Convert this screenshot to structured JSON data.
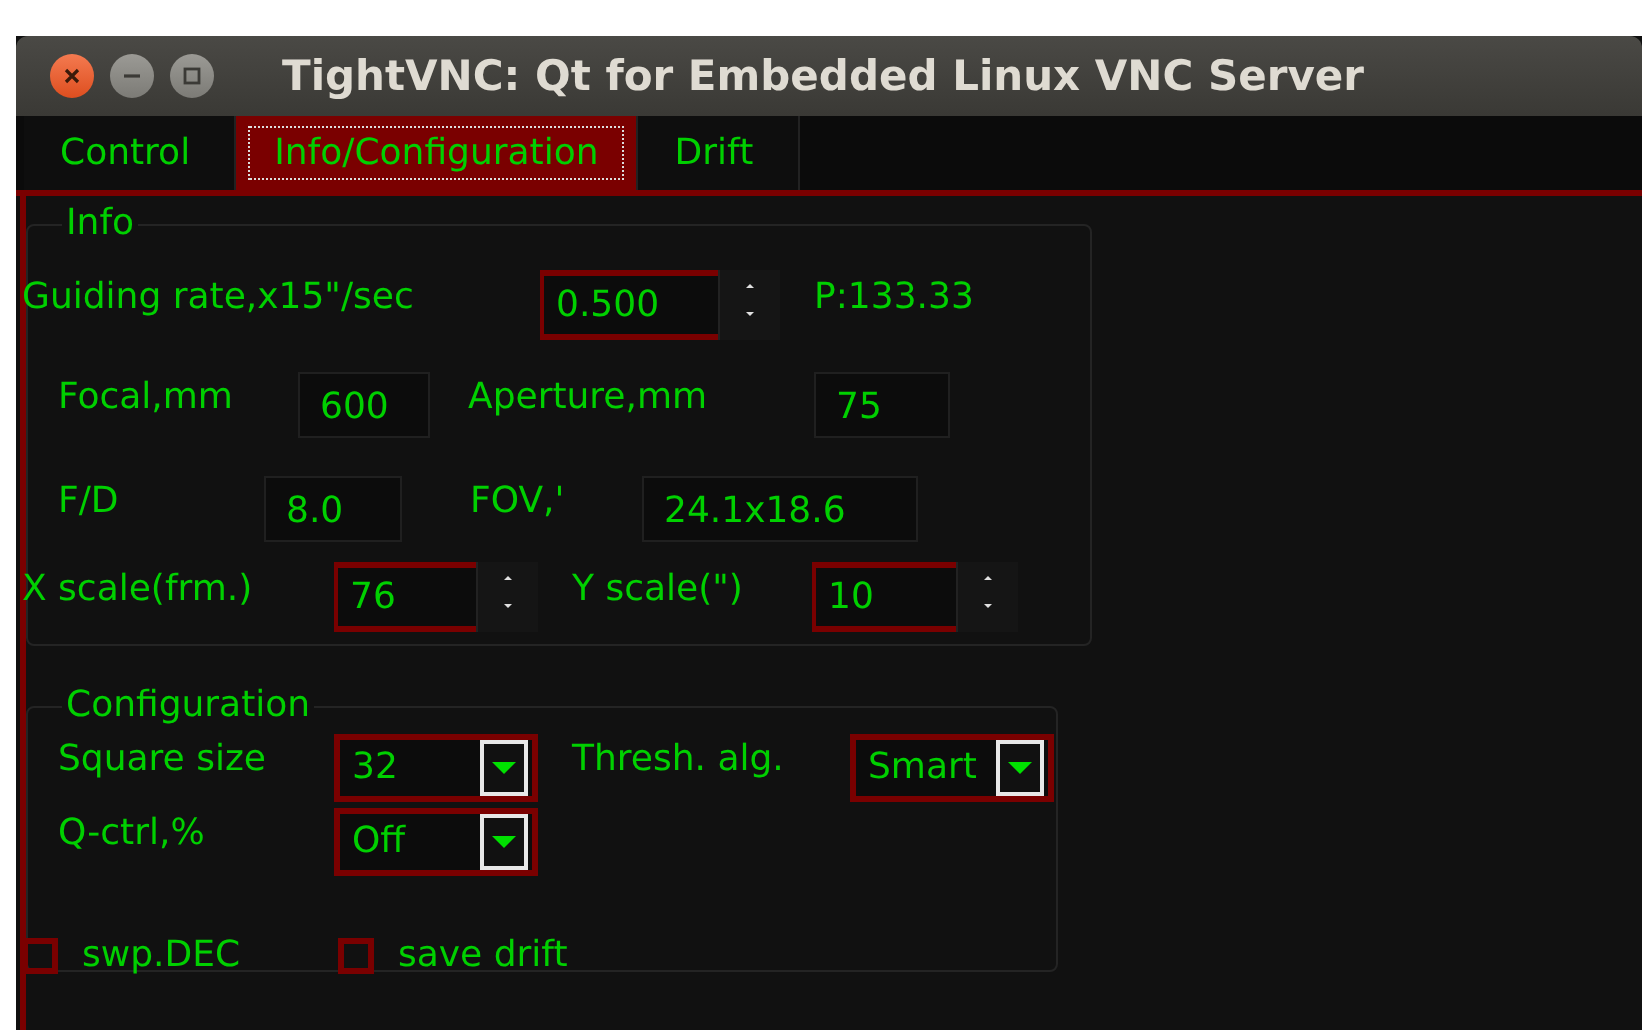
{
  "window": {
    "title": "TightVNC: Qt for Embedded Linux VNC Server"
  },
  "tabs": [
    {
      "label": "Control",
      "selected": false
    },
    {
      "label": "Info/Configuration",
      "selected": true
    },
    {
      "label": "Drift",
      "selected": false
    }
  ],
  "info": {
    "title": "Info",
    "lines": [
      {
        "fields": [
          {
            "label": "Guiding rate,x15\"/sec",
            "kind": "spin",
            "value": "0.500"
          }
        ],
        "readout": "P:133.33"
      },
      {
        "fields": [
          {
            "label": "Focal,mm",
            "kind": "field",
            "value": "600"
          },
          {
            "label": "Aperture,mm",
            "kind": "field",
            "value": "75"
          }
        ]
      },
      {
        "fields": [
          {
            "label": "F/D",
            "kind": "field",
            "value": "8.0"
          },
          {
            "label": "FOV,'",
            "kind": "field",
            "value": "24.1x18.6"
          }
        ]
      },
      {
        "fields": [
          {
            "label": "X scale(frm.)",
            "kind": "spin",
            "value": "76"
          },
          {
            "label": "Y scale(\")",
            "kind": "spin",
            "value": "10"
          }
        ]
      }
    ]
  },
  "configuration": {
    "title": "Configuration",
    "lines": [
      {
        "fields": [
          {
            "label": "Square size",
            "kind": "combo",
            "value": "32"
          },
          {
            "label": "Thresh. alg.",
            "kind": "combo",
            "value": "Smart"
          }
        ]
      },
      {
        "fields": [
          {
            "label": "Q-ctrl,%",
            "kind": "combo",
            "value": "Off"
          }
        ]
      }
    ],
    "checkboxes": [
      {
        "label": "swp.DEC",
        "checked": false
      },
      {
        "label": "save drift",
        "checked": false
      }
    ]
  }
}
